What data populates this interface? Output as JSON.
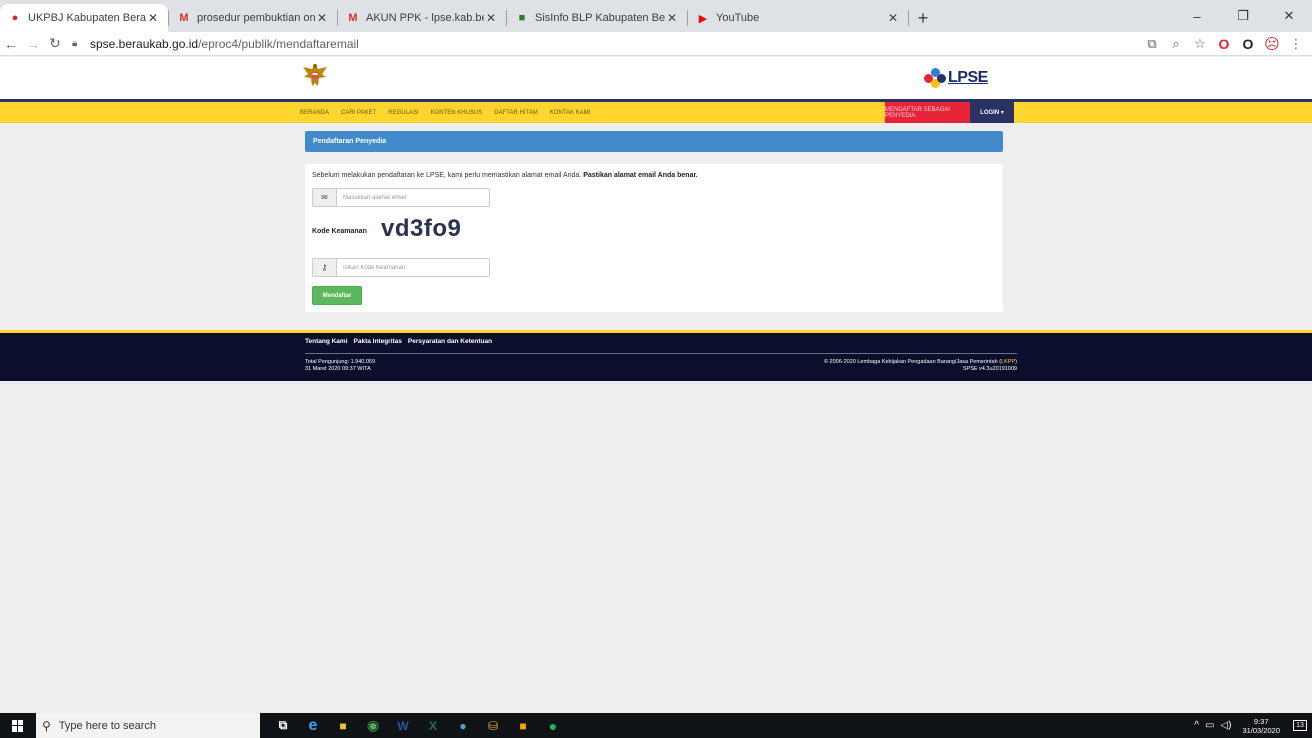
{
  "browser": {
    "tabs": [
      {
        "title": "UKPBJ Kabupaten Berau: Proses |",
        "favicon": "lpse-favicon",
        "active": true
      },
      {
        "title": "prosedur pembuktian online - ar",
        "favicon": "gmail-favicon",
        "active": false
      },
      {
        "title": "AKUN PPK - lpse.kab.berau@gm",
        "favicon": "gmail-favicon",
        "active": false
      },
      {
        "title": "SisInfo BLP Kabupaten Berau",
        "favicon": "shield-favicon",
        "active": false
      },
      {
        "title": "YouTube",
        "favicon": "youtube-favicon",
        "active": false
      }
    ],
    "url_host": "spse.beraukab.go.id",
    "url_path": "/eproc4/publik/mendaftaremail"
  },
  "site": {
    "logo_text": "LPSE",
    "nav": {
      "items": [
        "BERANDA",
        "CARI PAKET",
        "REGULASI",
        "KONTEN KHUSUS",
        "DAFTAR HITAM",
        "KONTAK KAMI"
      ],
      "register_label": "MENDAFTAR SEBAGAI PENYEDIA",
      "login_label": "LOGIN ▾"
    }
  },
  "form": {
    "panel_title": "Pendaftaran Penyedia",
    "intro_text": "Sebelum melakukan pendaftaran ke LPSE, kami perlu memastikan alamat email Anda.",
    "intro_bold": "Pastikan alamat email Anda benar.",
    "email_placeholder": "Masukkan alamat email",
    "captcha_label": "Kode Keamanan",
    "captcha_code": "vd3fo9",
    "captcha_placeholder": "Isikan Kode Keamanan",
    "submit_label": "Mendaftar"
  },
  "footer": {
    "links": [
      "Tentang Kami",
      "Pakta Integritas",
      "Persyaratan dan Ketentuan"
    ],
    "visitors": "Total Pengunjung: 1.940.059",
    "datetime": "31 Maret 2020 09:37 WITA",
    "copyright": "© 2006-2020 Lembaga Kebijakan Pengadaan Barang/Jasa Pemerintah (",
    "copyright_link": "LKPP",
    "copyright_end": ")",
    "version": "SPSE v4.3u20191009"
  },
  "taskbar": {
    "search_placeholder": "Type here to search",
    "time": "9:37",
    "date": "31/03/2020",
    "notification_count": "13"
  },
  "colors": {
    "navbar_yellow": "#ffd52e",
    "navy": "#2a3264",
    "panel_blue": "#428bca",
    "button_green": "#5cb85c",
    "register_red": "#e8243a"
  }
}
